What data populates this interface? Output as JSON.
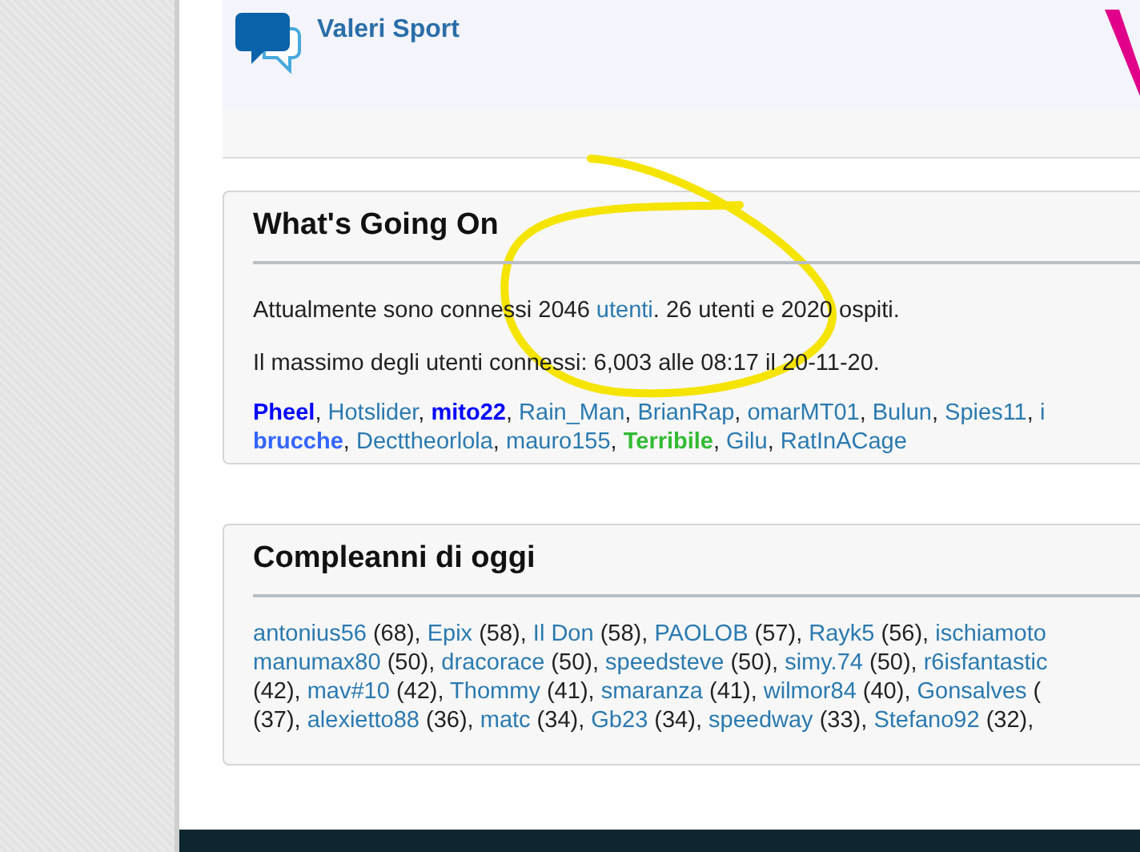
{
  "header": {
    "title": "Valeri Sport"
  },
  "whats_going_on": {
    "title": "What's Going On",
    "online_sentence": {
      "before": "Attualmente sono connessi 2046 ",
      "link": "utenti",
      "after": ". 26 utenti e 2020 ospiti."
    },
    "record": "Il massimo degli utenti connessi: 6,003 alle 08:17 il 20-11-20.",
    "user_lines": [
      [
        {
          "name": "Pheel",
          "kind": "highlighted",
          "color": "#0000ff",
          "sep": ", "
        },
        {
          "name": "Hotslider",
          "kind": "plain",
          "color": "#2a7ab0",
          "sep": ", "
        },
        {
          "name": "mito22",
          "kind": "highlighted",
          "color": "#0000ff",
          "sep": ", "
        },
        {
          "name": "Rain_Man",
          "kind": "plain",
          "color": "#2a7ab0",
          "sep": ", "
        },
        {
          "name": "BrianRap",
          "kind": "plain",
          "color": "#2a7ab0",
          "sep": ", "
        },
        {
          "name": "omarMT01",
          "kind": "plain",
          "color": "#2a7ab0",
          "sep": ", "
        },
        {
          "name": "Bulun",
          "kind": "plain",
          "color": "#2a7ab0",
          "sep": ", "
        },
        {
          "name": "Spies11",
          "kind": "plain",
          "color": "#2a7ab0",
          "sep": ", "
        },
        {
          "name": "i",
          "kind": "plain",
          "color": "#2a7ab0"
        }
      ],
      [
        {
          "name": "brucche",
          "kind": "highlighted",
          "color": "#3366ff",
          "sep": ", "
        },
        {
          "name": "Decttheorlola",
          "kind": "plain",
          "color": "#2a7ab0",
          "sep": ", "
        },
        {
          "name": "mauro155",
          "kind": "plain",
          "color": "#2a7ab0",
          "sep": ", "
        },
        {
          "name": "Terribile",
          "kind": "highlighted",
          "color": "#33bb33",
          "sep": ", "
        },
        {
          "name": "Gilu",
          "kind": "plain",
          "color": "#2a7ab0",
          "sep": ", "
        },
        {
          "name": "RatInACage",
          "kind": "plain",
          "color": "#2a7ab0"
        }
      ]
    ]
  },
  "birthdays": {
    "title": "Compleanni di oggi",
    "lines": [
      [
        {
          "kind": "link",
          "text": "antonius56"
        },
        {
          "kind": "text",
          "text": " (68), "
        },
        {
          "kind": "link",
          "text": "Epix"
        },
        {
          "kind": "text",
          "text": " (58), "
        },
        {
          "kind": "link",
          "text": "Il Don"
        },
        {
          "kind": "text",
          "text": " (58), "
        },
        {
          "kind": "link",
          "text": "PAOLOB"
        },
        {
          "kind": "text",
          "text": " (57), "
        },
        {
          "kind": "link",
          "text": "Rayk5"
        },
        {
          "kind": "text",
          "text": " (56), "
        },
        {
          "kind": "link",
          "text": "ischiamoto"
        }
      ],
      [
        {
          "kind": "link",
          "text": "manumax80"
        },
        {
          "kind": "text",
          "text": " (50), "
        },
        {
          "kind": "link",
          "text": "dracorace"
        },
        {
          "kind": "text",
          "text": " (50), "
        },
        {
          "kind": "link",
          "text": "speedsteve"
        },
        {
          "kind": "text",
          "text": " (50), "
        },
        {
          "kind": "link",
          "text": "simy.74"
        },
        {
          "kind": "text",
          "text": " (50), "
        },
        {
          "kind": "link",
          "text": "r6isfantastic"
        }
      ],
      [
        {
          "kind": "text",
          "text": "(42), "
        },
        {
          "kind": "link",
          "text": "mav#10"
        },
        {
          "kind": "text",
          "text": " (42), "
        },
        {
          "kind": "link",
          "text": "Thommy"
        },
        {
          "kind": "text",
          "text": " (41), "
        },
        {
          "kind": "link",
          "text": "smaranza"
        },
        {
          "kind": "text",
          "text": " (41), "
        },
        {
          "kind": "link",
          "text": "wilmor84"
        },
        {
          "kind": "text",
          "text": " (40), "
        },
        {
          "kind": "link",
          "text": "Gonsalves"
        },
        {
          "kind": "text",
          "text": " ("
        }
      ],
      [
        {
          "kind": "text",
          "text": "(37), "
        },
        {
          "kind": "link",
          "text": "alexietto88"
        },
        {
          "kind": "text",
          "text": " (36), "
        },
        {
          "kind": "link",
          "text": "matc"
        },
        {
          "kind": "text",
          "text": " (34), "
        },
        {
          "kind": "link",
          "text": "Gb23"
        },
        {
          "kind": "text",
          "text": " (34), "
        },
        {
          "kind": "link",
          "text": "speedway"
        },
        {
          "kind": "text",
          "text": " (33), "
        },
        {
          "kind": "link",
          "text": "Stefano92"
        },
        {
          "kind": "text",
          "text": " (32),"
        }
      ]
    ]
  }
}
